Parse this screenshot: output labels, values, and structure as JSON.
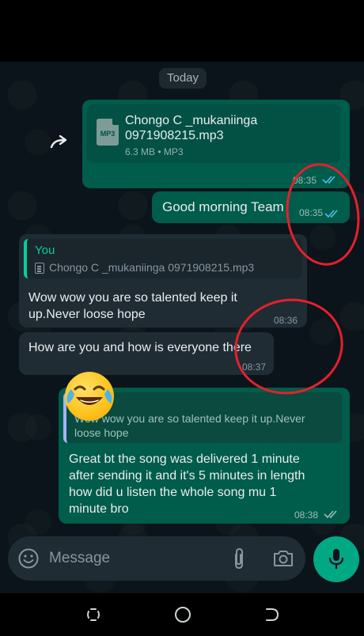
{
  "chat": {
    "date_chip": "Today",
    "messages": {
      "file": {
        "filename": "Chongo C _mukaniinga 0971908215.mp3",
        "file_badge": "MP3",
        "meta": "6.3 MB • MP3",
        "time": "08:35",
        "status": "read"
      },
      "good_morning": {
        "text": "Good morning Team",
        "time": "08:35",
        "status": "read"
      },
      "reply_in": {
        "quote_author": "You",
        "quote_text": "Chongo C _mukaniinga 0971908215.mp3",
        "text_line1": "Wow wow you are so talented keep it",
        "text_line2": "up.Never loose hope",
        "time": "08:36"
      },
      "how_are_you": {
        "text": "How are you and how is everyone there",
        "time": "08:37"
      },
      "reply_out": {
        "quote_line1": "Wow wow you are so talented keep it up.Never",
        "quote_line2": "loose hope",
        "text_line1": "Great bt the song was delivered 1 minute",
        "text_line2": "after sending it and it's 5 minutes in length",
        "text_line3": "how did u listen the whole song mu 1",
        "text_line4": "minute bro",
        "time": "08:38",
        "status": "read"
      }
    },
    "emoji": "tears-of-joy",
    "annotation_color": "#e5202d"
  },
  "input": {
    "placeholder": "Message"
  },
  "icons": [
    "forward-icon",
    "emoji-icon",
    "attach-icon",
    "camera-icon",
    "mic-icon",
    "double-check-icon",
    "recents-icon",
    "home-icon",
    "back-icon"
  ],
  "colors": {
    "outgoing_bubble": "#005c4b",
    "incoming_bubble": "#1f2c34",
    "accent": "#00a884",
    "read_ticks": "#53bdeb",
    "background": "#0b141a"
  }
}
